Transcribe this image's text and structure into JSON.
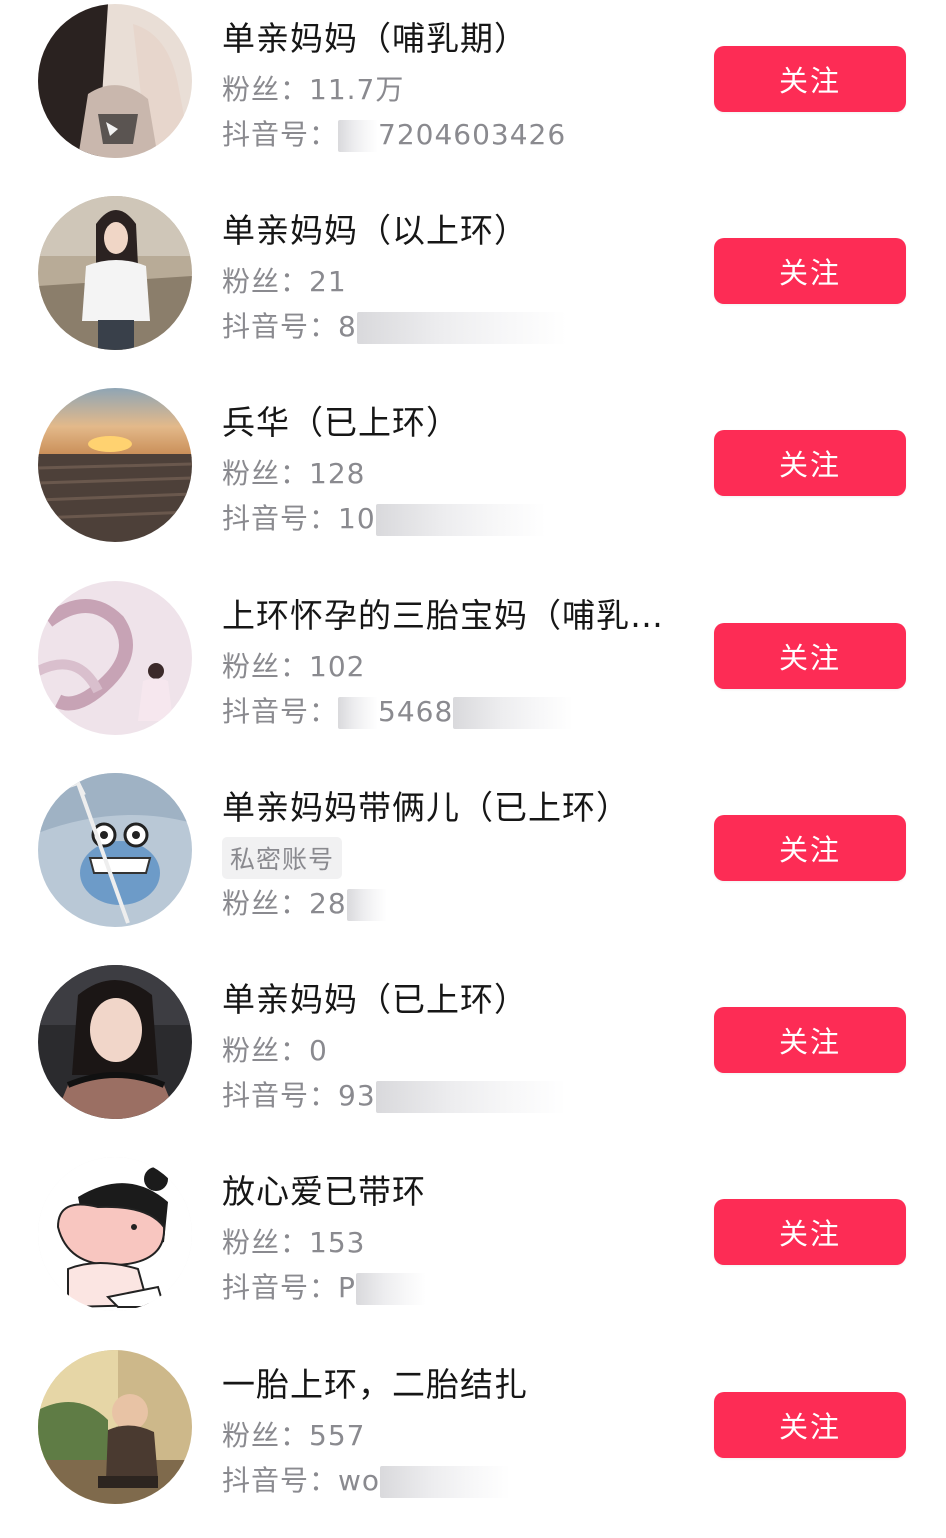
{
  "labels": {
    "fans": "粉丝：",
    "douyin": "抖音号：",
    "follow": "关注"
  },
  "accounts": [
    {
      "name": "单亲妈妈（哺乳期）",
      "fans": "11.7万",
      "douyin_visible": "7204603426",
      "avatar": "woman-long-hair-avatar"
    },
    {
      "name": "单亲妈妈（以上环）",
      "fans": "21",
      "douyin_visible": "8",
      "avatar": "woman-white-tshirt-avatar"
    },
    {
      "name": "兵华（已上环）",
      "fans": "128",
      "douyin_visible": "10",
      "avatar": "sunset-field-avatar"
    },
    {
      "name": "上环怀孕的三胎宝妈（哺乳…",
      "fans": "102",
      "douyin_visible": "5468",
      "avatar": "dragon-fairy-avatar"
    },
    {
      "name": "单亲妈妈带俩儿（已上环）",
      "badge": "私密账号",
      "fans": "28",
      "avatar": "cartoon-frog-avatar"
    },
    {
      "name": "单亲妈妈（已上环）",
      "fans": "0",
      "douyin_visible": "93",
      "avatar": "woman-car-selfie-avatar"
    },
    {
      "name": "放心爱已带环",
      "fans": "153",
      "douyin_visible": "P",
      "avatar": "cartoon-baby-avatar"
    },
    {
      "name": "一胎上环，二胎结扎",
      "fans": "557",
      "douyin_visible": "wo",
      "avatar": "baby-outdoor-avatar"
    }
  ],
  "colors": {
    "follow_button": "#fd2c55",
    "secondary_text": "#8a8a8f",
    "title_text": "#161616"
  }
}
